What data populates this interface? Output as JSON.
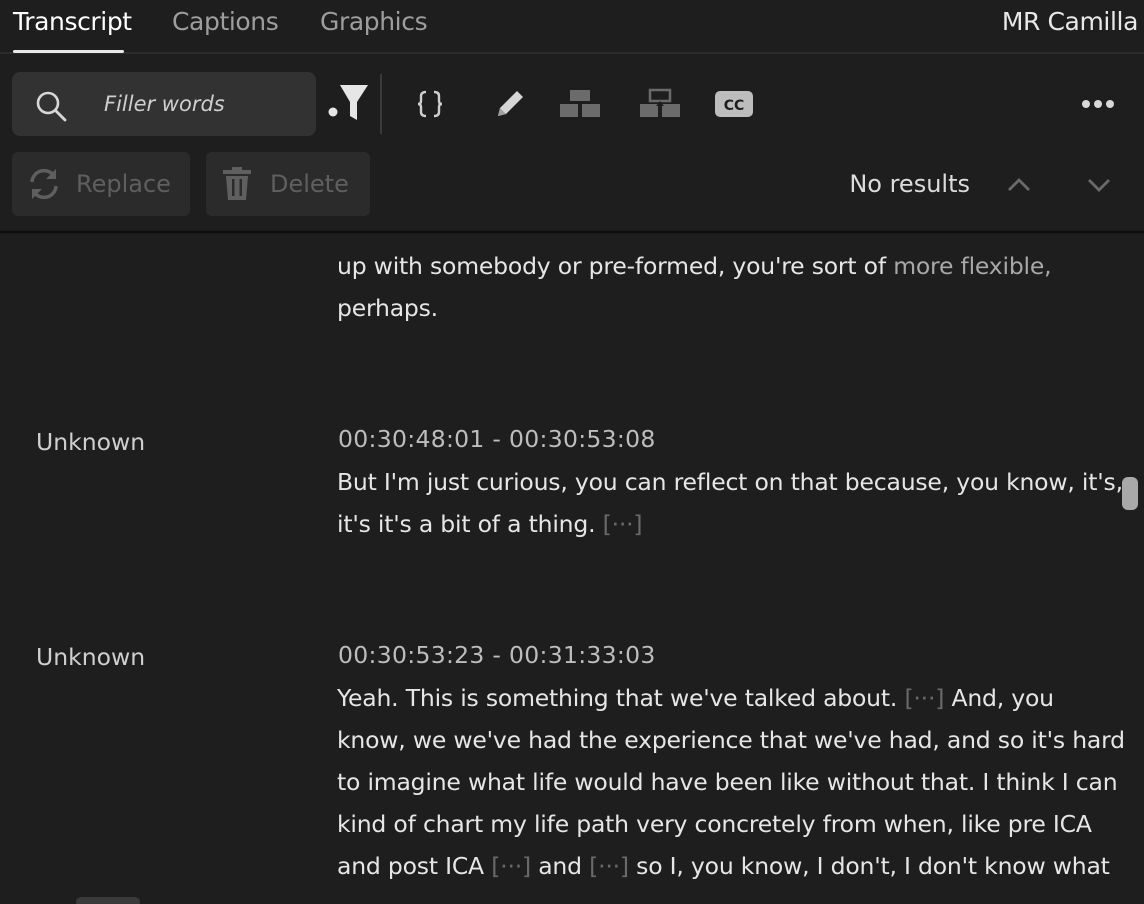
{
  "tabs": [
    {
      "label": "Transcript",
      "active": true
    },
    {
      "label": "Captions",
      "active": false
    },
    {
      "label": "Graphics",
      "active": false
    }
  ],
  "owner_name": "MR Camilla",
  "search": {
    "placeholder": "Filler words",
    "value": ""
  },
  "toolbar_icons": [
    "search-icon",
    "filter-icon",
    "code-braces-icon",
    "pencil-icon",
    "merge-segments-icon",
    "split-segments-icon",
    "closed-captions-icon",
    "more-options-icon"
  ],
  "cc_label": "CC",
  "actions": {
    "replace_label": "Replace",
    "delete_label": "Delete"
  },
  "results_text": "No results",
  "colors": {
    "background": "#1e1e1e",
    "panel": "#323232",
    "text": "#e6e6e6",
    "muted": "#9e9e9e",
    "gap_marker": "#6a6a6a"
  },
  "transcript": {
    "partial_top": {
      "line1_a": "up with somebody or pre-formed, you're sort of ",
      "line1_b": "more flexible,",
      "line2": "perhaps."
    },
    "segments": [
      {
        "speaker": "Unknown",
        "timecode": "00:30:48:01 - 00:30:53:08",
        "line1": "But I'm just curious, you can reflect on that because, you know, it's,",
        "line2": "it's it's a bit of a thing.",
        "gap": "[···]"
      },
      {
        "speaker": "Unknown",
        "timecode": "00:30:53:23 - 00:31:33:03",
        "line1_a": "Yeah. This is something that we've talked about.",
        "line1_b": "And, you",
        "line2": "know, we we've had the experience that we've had, and so it's hard",
        "line3": "to imagine what life would have been like without that. I think I can",
        "line4": "kind of chart my life path very concretely from when, like pre ICA",
        "line5_a": "and post ICA",
        "line5_b": "and",
        "line5_c": "so I, you know, I don't, I don't know what",
        "gap": "[···]"
      }
    ]
  }
}
